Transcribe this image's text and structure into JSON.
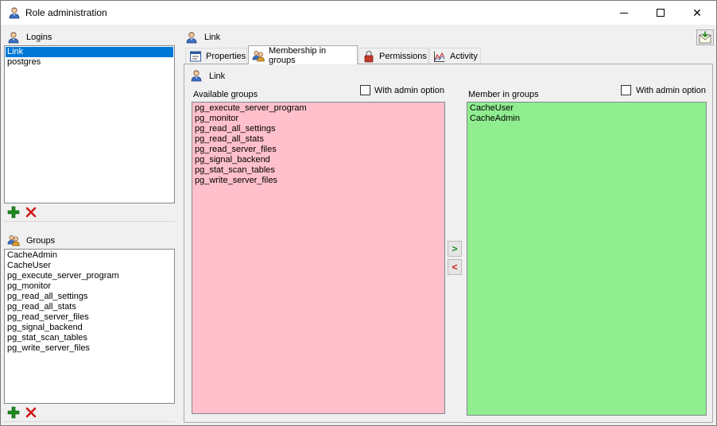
{
  "window": {
    "title": "Role administration",
    "close_glyph": "✕"
  },
  "logins": {
    "label": "Logins",
    "items": [
      "Link",
      "postgres"
    ],
    "selected": "Link"
  },
  "groups": {
    "label": "Groups",
    "items": [
      "CacheAdmin",
      "CacheUser",
      "pg_execute_server_program",
      "pg_monitor",
      "pg_read_all_settings",
      "pg_read_all_stats",
      "pg_read_server_files",
      "pg_signal_backend",
      "pg_stat_scan_tables",
      "pg_write_server_files"
    ]
  },
  "role_header": {
    "name": "Link"
  },
  "tabs": [
    {
      "label": "Properties",
      "icon": "properties-icon"
    },
    {
      "label": "Membership in groups",
      "icon": "membership-icon",
      "active": true
    },
    {
      "label": "Permissions",
      "icon": "lock-icon"
    },
    {
      "label": "Activity",
      "icon": "activity-chart-icon"
    }
  ],
  "membership": {
    "role_name": "Link",
    "available": {
      "label": "Available groups",
      "admin_option_label": "With admin option",
      "admin_option_checked": false,
      "color": "#ffc0cb",
      "items": [
        "pg_execute_server_program",
        "pg_monitor",
        "pg_read_all_settings",
        "pg_read_all_stats",
        "pg_read_server_files",
        "pg_signal_backend",
        "pg_stat_scan_tables",
        "pg_write_server_files"
      ]
    },
    "member_of": {
      "label": "Member in groups",
      "admin_option_label": "With admin option",
      "admin_option_checked": false,
      "color": "#90ee90",
      "items": [
        "CacheUser",
        "CacheAdmin"
      ]
    },
    "add_label": ">",
    "remove_label": "<"
  },
  "colors": {
    "selection": "#0078d7",
    "add_green": "#1a8a1a",
    "delete_red": "#d01818"
  }
}
